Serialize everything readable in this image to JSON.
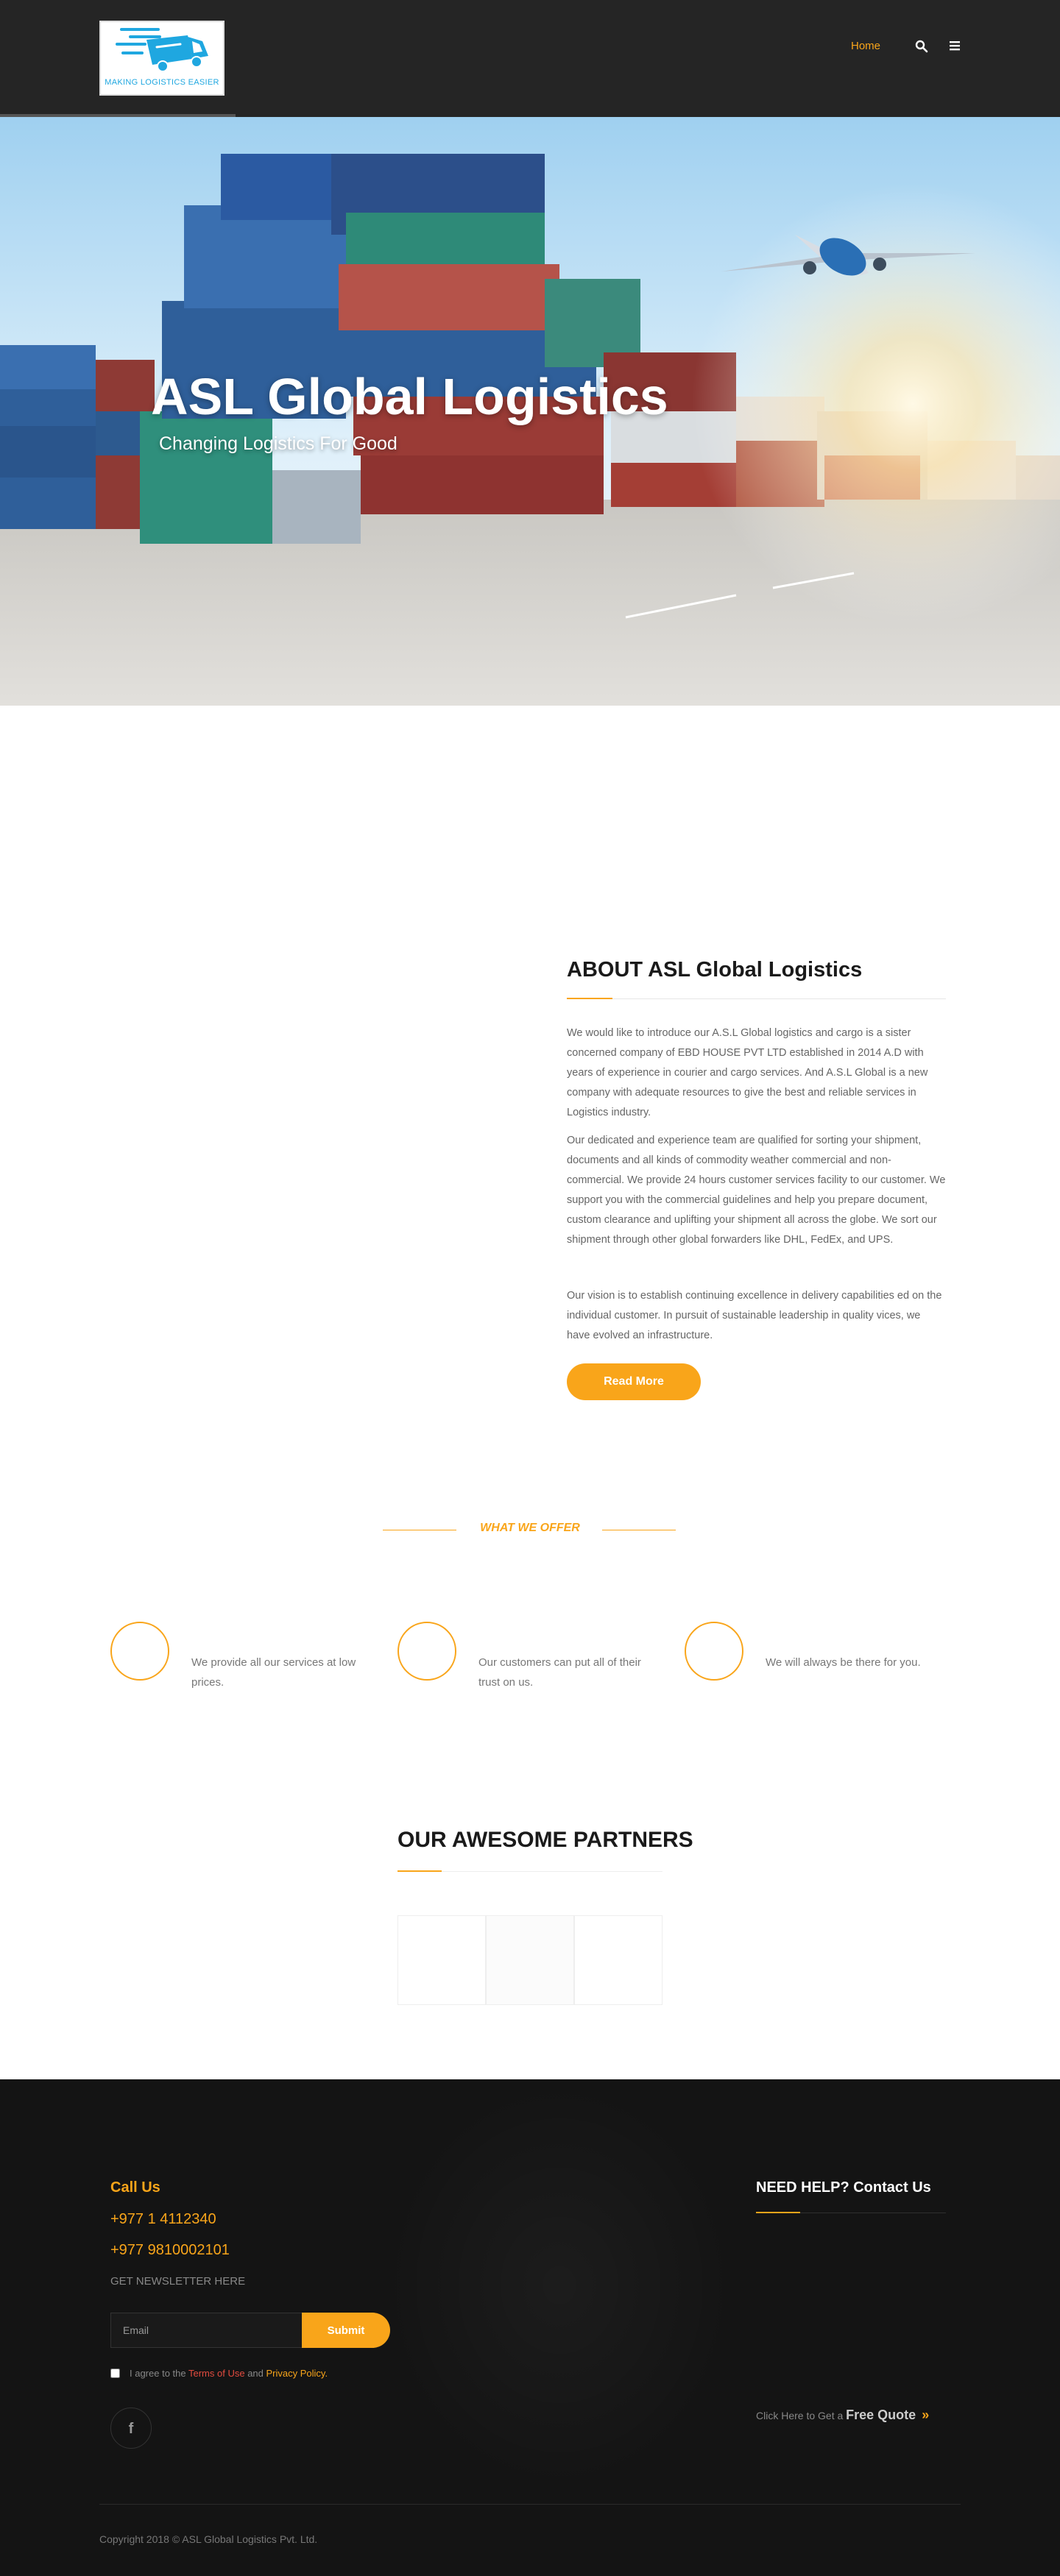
{
  "header": {
    "logo_text": "MAKING LOGISTICS EASIER",
    "nav": {
      "home_label": "Home"
    },
    "icons": {
      "search": "search-icon",
      "menu": "menu-icon"
    }
  },
  "hero": {
    "title": "ASL Global Logistics",
    "subtitle": "Changing Logistics For Good"
  },
  "about": {
    "title": "ABOUT ASL Global Logistics",
    "paragraphs": [
      "We would like to introduce our A.S.L Global logistics and cargo is a sister concerned company of EBD HOUSE PVT LTD established in 2014 A.D with years of experience in courier and cargo services. And A.S.L Global is a new company with adequate resources to give the best and reliable services in Logistics industry.",
      "Our dedicated and experience team are qualified for sorting your shipment, documents and all kinds of commodity weather commercial and non-commercial. We provide 24 hours customer services facility to our customer. We support you with the commercial guidelines and help you prepare document, custom clearance and uplifting your shipment all across the globe. We sort our shipment through other global forwarders like DHL, FedEx, and UPS.",
      "Our vision is to establish continuing excellence in delivery capabilities ed on the individual customer. In pursuit of sustainable leadership in quality vices, we have evolved an infrastructure."
    ],
    "read_more_label": "Read More"
  },
  "offer": {
    "heading": "WHAT WE OFFER",
    "items": [
      {
        "text": "We provide all our services at low prices."
      },
      {
        "text": "Our customers can put all of their trust on us."
      },
      {
        "text": "We will always be there for you."
      }
    ]
  },
  "partners": {
    "title": "OUR AWESOME PARTNERS"
  },
  "footer": {
    "call_us": "Call Us",
    "phones": [
      "+977 1 4112340",
      "+977 9810002101"
    ],
    "newsletter_label": "GET NEWSLETTER HERE",
    "email_placeholder": "Email",
    "submit_label": "Submit",
    "agree_prefix": "I agree to the ",
    "terms_label": "Terms of Use",
    "agree_and": " and ",
    "privacy_label": "Privacy Policy.",
    "facebook_icon": "facebook-icon",
    "need_help": "NEED HELP? Contact Us",
    "quote_prefix": "Click Here to Get a ",
    "quote_label": "Free Quote",
    "quote_arrows": "»",
    "copyright": "Copyright 2018 © ASL Global Logistics Pvt. Ltd."
  },
  "colors": {
    "accent": "#f9a51a",
    "header_bg": "#252525",
    "footer_bg": "#141414",
    "terms_link": "#e34b3f"
  }
}
